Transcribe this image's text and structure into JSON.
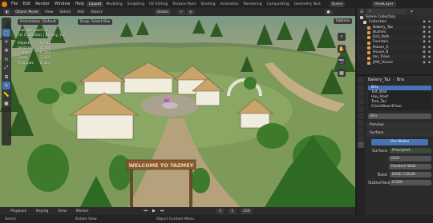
{
  "topbar": {
    "menus": [
      "File",
      "Edit",
      "Render",
      "Window",
      "Help"
    ],
    "workspaces": [
      "Layout",
      "Modeling",
      "Sculpting",
      "UV Editing",
      "Texture Paint",
      "Shading",
      "Animation",
      "Rendering",
      "Compositing",
      "Geometry Nod"
    ],
    "active_workspace": "Layout",
    "scene": "Scene",
    "view_layer": "ViewLayer"
  },
  "viewport_header": {
    "mode": "Object Mode",
    "menus": [
      "View",
      "Select",
      "Add",
      "Object"
    ],
    "orientation": "Global",
    "orientation_label": "Orientation:",
    "orientation_value": "Default",
    "drag_label": "Drag:",
    "drag_value": "Select Box",
    "options": "Options"
  },
  "viewport": {
    "view_name": "User Perspective",
    "collection": "(1) Collection | Bakery_Taz",
    "stats": [
      {
        "label": "Objects",
        "value": "0 / 93"
      },
      {
        "label": "Vertices",
        "value": "4,464"
      },
      {
        "label": "Edges",
        "value": "6,543"
      },
      {
        "label": "Faces",
        "value": "2,269"
      },
      {
        "label": "Triangles",
        "value": "6,313"
      }
    ],
    "sign_text": "WELCOME TO TAZMEY"
  },
  "timeline": {
    "menus": [
      "Playback",
      "Keying",
      "View",
      "Marker"
    ],
    "frame": "1",
    "start": "1",
    "end": "250"
  },
  "statusbar": {
    "items": [
      "Select",
      "Rotate View",
      "Object Context Menu"
    ]
  },
  "outliner": {
    "rows": [
      {
        "name": "Scene Collection",
        "icon": "collection-icon",
        "color": "#cccccc"
      },
      {
        "name": "Collection",
        "icon": "collection-icon",
        "color": "#cccccc"
      },
      {
        "name": "Bakery_Taz",
        "icon": "object-icon",
        "color": "#e8a04a"
      },
      {
        "name": "Bushes",
        "icon": "object-icon",
        "color": "#e8a04a"
      },
      {
        "name": "Dirt_Path",
        "icon": "object-icon",
        "color": "#e8a04a"
      },
      {
        "name": "Fountain",
        "icon": "object-icon",
        "color": "#e8a04a"
      },
      {
        "name": "House_A",
        "icon": "object-icon",
        "color": "#e8a04a"
      },
      {
        "name": "House_B",
        "icon": "object-icon",
        "color": "#e8a04a"
      },
      {
        "name": "Inn_Trees",
        "icon": "object-icon",
        "color": "#e8a04a"
      },
      {
        "name": "JAW_House",
        "icon": "object-icon",
        "color": "#e8a04a"
      }
    ]
  },
  "properties": {
    "object": "Bakery_Taz",
    "material_slot": "Bris",
    "materials": [
      "Bris",
      "Toit_Wall",
      "Hay_Roof",
      "Tree_Taz",
      "CheckBoardFloor"
    ],
    "selected_material": "Bris",
    "sections": [
      "Preview",
      "Surface"
    ],
    "use_nodes": "Use Nodes",
    "surface_label": "Surface",
    "surface_value": "Principled...",
    "distribution": "GGX",
    "subsurface_method": "Random Walk",
    "base_color_label": "Base",
    "base_color": "BASE COLOR",
    "subsurface_label": "Subsurface",
    "subsurface_value": "0.000"
  },
  "colors": {
    "accent": "#4772b3",
    "orange": "#e87d0d"
  }
}
